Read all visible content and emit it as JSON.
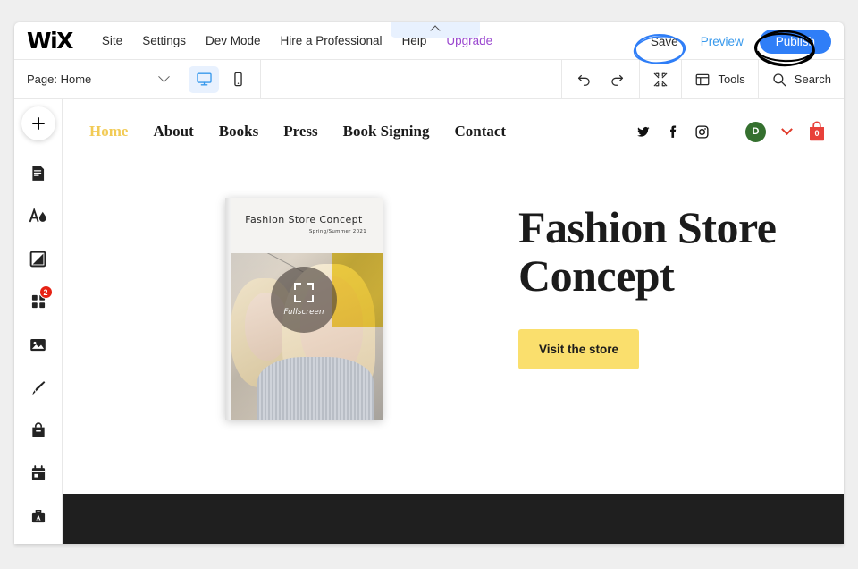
{
  "editor": {
    "brand": "WiX",
    "menu": [
      {
        "label": "Site",
        "name": "menu-site"
      },
      {
        "label": "Settings",
        "name": "menu-settings"
      },
      {
        "label": "Dev Mode",
        "name": "menu-dev-mode"
      },
      {
        "label": "Hire a Professional",
        "name": "menu-hire-a-professional"
      },
      {
        "label": "Help",
        "name": "menu-help"
      },
      {
        "label": "Upgrade",
        "name": "menu-upgrade"
      }
    ],
    "actions": {
      "save": "Save",
      "preview": "Preview",
      "publish": "Publish"
    },
    "annotations": {
      "save_circle_color": "#2f7ef7",
      "publish_circle_color": "#000000"
    },
    "toolbar": {
      "page_key": "Page:",
      "page_value": "Home",
      "desktop_icon": "desktop-icon",
      "mobile_icon": "mobile-icon",
      "undo_icon": "undo-icon",
      "redo_icon": "redo-icon",
      "zoomout_icon": "zoom-out-icon",
      "tools_label": "Tools",
      "search_label": "Search"
    },
    "rail": [
      {
        "name": "add-elements",
        "icon": "plus-icon",
        "badge": ""
      },
      {
        "name": "pages-menu",
        "icon": "pages-icon",
        "badge": ""
      },
      {
        "name": "site-design",
        "icon": "theme-icon",
        "badge": ""
      },
      {
        "name": "background",
        "icon": "background-icon",
        "badge": ""
      },
      {
        "name": "apps-market",
        "icon": "apps-grid-icon",
        "badge": "2"
      },
      {
        "name": "media-manager",
        "icon": "image-icon",
        "badge": ""
      },
      {
        "name": "blog",
        "icon": "pen-icon",
        "badge": ""
      },
      {
        "name": "store",
        "icon": "shopping-bag-icon",
        "badge": ""
      },
      {
        "name": "bookings",
        "icon": "calendar-icon",
        "badge": ""
      },
      {
        "name": "business-tools",
        "icon": "briefcase-a-icon",
        "badge": ""
      }
    ],
    "accent_blue": "#2f7ef7",
    "badge_red": "#e62214"
  },
  "site": {
    "nav": [
      {
        "label": "Home",
        "active": true
      },
      {
        "label": "About",
        "active": false
      },
      {
        "label": "Books",
        "active": false
      },
      {
        "label": "Press",
        "active": false
      },
      {
        "label": "Book Signing",
        "active": false
      },
      {
        "label": "Contact",
        "active": false
      }
    ],
    "active_nav_color": "#f2cb56",
    "social": [
      "twitter-icon",
      "facebook-icon",
      "instagram-icon"
    ],
    "account": {
      "avatar_initial": "D",
      "avatar_color": "#35702f",
      "chevron_color": "#e03b2b"
    },
    "cart": {
      "count": "0",
      "color": "#e8413a"
    },
    "hero": {
      "title_line1": "Fashion Store",
      "title_line2": "Concept",
      "cta_label": "Visit the store",
      "cta_color": "#fadf6d"
    },
    "magazine": {
      "cover_title": "Fashion Store Concept",
      "cover_subtitle": "Spring/Summer 2021",
      "overlay_label": "Fullscreen",
      "overlay_icon": "fullscreen-icon",
      "next_icon": "chevron-right-icon"
    },
    "footer_color": "#1f1f1f"
  }
}
